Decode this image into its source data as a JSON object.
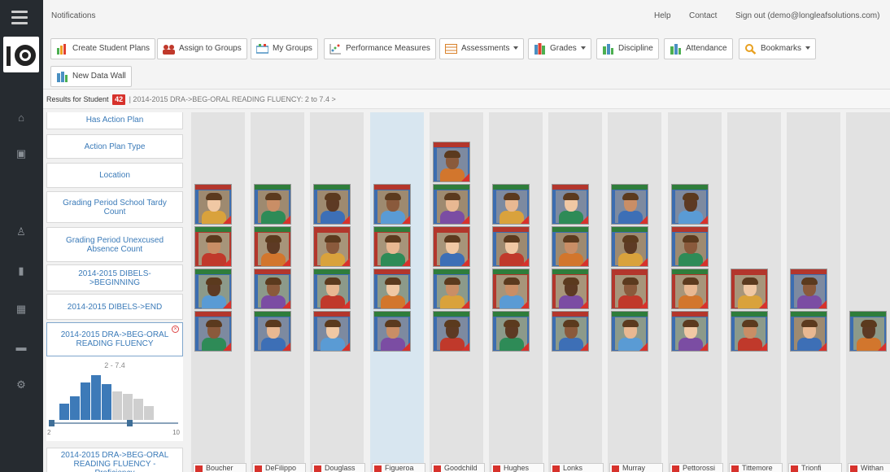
{
  "header": {
    "title": "Notifications",
    "help": "Help",
    "contact": "Contact",
    "signout": "Sign out (demo@longleafsolutions.com)"
  },
  "toolbar": {
    "buttons": [
      {
        "label": "Create Student Plans",
        "icon": "chart-icon"
      },
      {
        "label": "Assign to Groups",
        "icon": "people-icon"
      },
      {
        "label": "My Groups",
        "icon": "groups-icon"
      },
      {
        "label": "Performance Measures",
        "icon": "scatter-icon"
      },
      {
        "label": "Assessments",
        "icon": "table-icon",
        "dropdown": true
      },
      {
        "label": "Grades",
        "icon": "books-icon",
        "dropdown": true
      },
      {
        "label": "Discipline",
        "icon": "bar-icon"
      },
      {
        "label": "Attendance",
        "icon": "bar-icon"
      },
      {
        "label": "Bookmarks",
        "icon": "search-icon",
        "dropdown": true
      },
      {
        "label": "New Data Wall",
        "icon": "wall-icon"
      }
    ]
  },
  "results": {
    "prefix": "Results for Student",
    "count": "42",
    "crumb": "| 2014-2015 DRA->BEG-ORAL READING FLUENCY: 2 to 7.4 >"
  },
  "filters": [
    "Has Action Plan",
    "Action Plan Type",
    "Location",
    "Grading Period School Tardy Count",
    "Grading Period Unexcused Absence Count",
    "2014-2015 DIBELS->BEGINNING",
    "2014-2015 DIBELS->END",
    "2014-2015 DRA->BEG-ORAL READING FLUENCY",
    "2014-2015 DRA->BEG-ORAL READING FLUENCY - Proficiency"
  ],
  "histogram": {
    "range_label": "2 - 7.4",
    "min_label": "2",
    "max_label": "10",
    "bars": [
      0.35,
      0.5,
      0.8,
      0.95,
      0.75,
      0.6,
      0.55,
      0.45,
      0.3
    ],
    "selected_count": 5
  },
  "wall": {
    "columns": [
      {
        "name": "Boucher",
        "cards": 4,
        "highlight": false
      },
      {
        "name": "DeFilippo",
        "cards": 4,
        "highlight": false
      },
      {
        "name": "Douglass",
        "cards": 4,
        "highlight": false
      },
      {
        "name": "Figueroa",
        "cards": 4,
        "highlight": true
      },
      {
        "name": "Goodchild",
        "cards": 5,
        "highlight": false
      },
      {
        "name": "Hughes",
        "cards": 4,
        "highlight": false
      },
      {
        "name": "Lonks",
        "cards": 4,
        "highlight": false
      },
      {
        "name": "Murray",
        "cards": 4,
        "highlight": false
      },
      {
        "name": "Pettorossi",
        "cards": 4,
        "highlight": false
      },
      {
        "name": "Tittemore",
        "cards": 2,
        "highlight": false
      },
      {
        "name": "Trionfi",
        "cards": 2,
        "highlight": false
      },
      {
        "name": "Withan",
        "cards": 1,
        "highlight": false
      }
    ],
    "card_palette": {
      "frame": [
        "#3c6db0",
        "#3c6db0",
        "#3c6db0",
        "#b3362c"
      ],
      "caption": [
        "#2f7d3b",
        "#b3362c",
        "#2f7d3b",
        "#2f7d3b",
        "#b3362c"
      ],
      "shirt": [
        "#d2762d",
        "#3d6fb6",
        "#c0392b",
        "#2e8b57",
        "#7b4da3",
        "#d9a23c",
        "#5a9bd4"
      ],
      "skin": [
        "#e8b892",
        "#c98e66",
        "#8a5a3c",
        "#f0c8a4",
        "#5d3a24"
      ],
      "hair": [
        "#5b3a1e",
        "#2a1b10",
        "#b58a4a",
        "#111111",
        "#8a5a2c"
      ],
      "bg": [
        "#9e8a70",
        "#7d8aa0",
        "#8c9a8a",
        "#a7957a"
      ]
    }
  }
}
